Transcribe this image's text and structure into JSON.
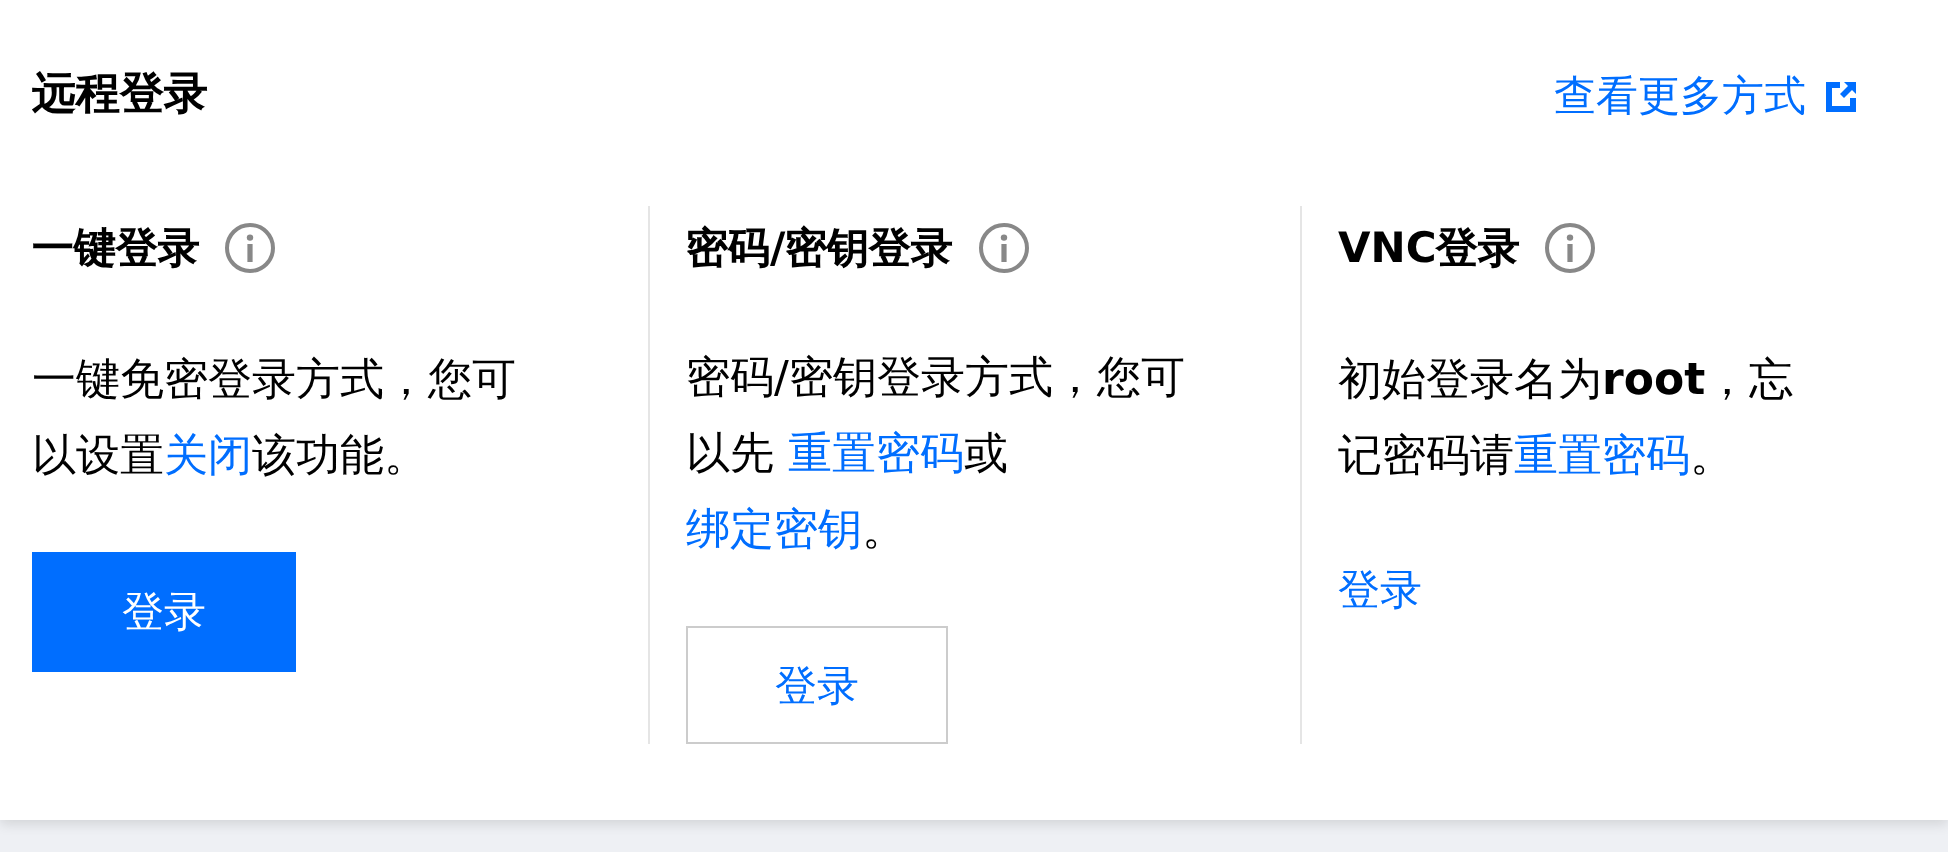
{
  "title": "远程登录",
  "more_link": "查看更多方式",
  "methods": [
    {
      "heading": "一键登录",
      "description": [
        {
          "kind": "text",
          "text": "一键免密登录方式，您可以设置"
        },
        {
          "kind": "link",
          "text": "关闭"
        },
        {
          "kind": "text",
          "text": "该功能。"
        }
      ],
      "button": {
        "kind": "primary",
        "label": "登录"
      }
    },
    {
      "heading": "密码/密钥登录",
      "description": [
        {
          "kind": "text",
          "text": "密码/密钥登录方式，您可以先 "
        },
        {
          "kind": "link",
          "text": "重置密码"
        },
        {
          "kind": "text",
          "text": "或"
        },
        {
          "kind": "link",
          "text": "绑定密钥"
        },
        {
          "kind": "text",
          "text": "。"
        }
      ],
      "button": {
        "kind": "outline",
        "label": "登录"
      }
    },
    {
      "heading": "VNC登录",
      "description": [
        {
          "kind": "text",
          "text": "初始登录名为"
        },
        {
          "kind": "bold",
          "text": "root"
        },
        {
          "kind": "text",
          "text": "，忘记密码请"
        },
        {
          "kind": "link",
          "text": "重置密码"
        },
        {
          "kind": "text",
          "text": "。"
        }
      ],
      "button": {
        "kind": "text",
        "label": "登录"
      }
    }
  ]
}
